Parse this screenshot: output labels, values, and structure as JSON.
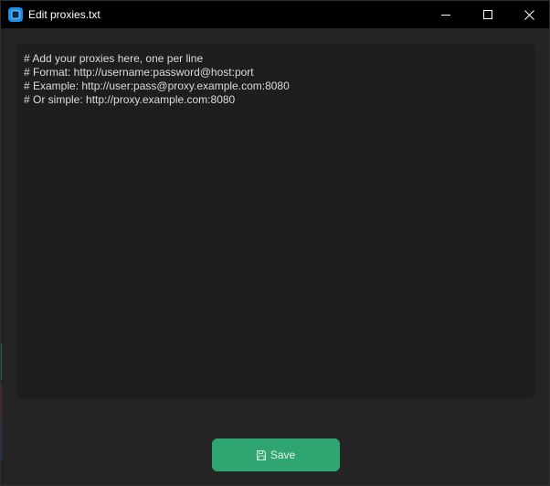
{
  "window": {
    "title": "Edit proxies.txt",
    "icon": "app-icon"
  },
  "titlebar": {
    "controls": [
      "minimize-icon",
      "maximize-icon",
      "close-icon"
    ]
  },
  "editor": {
    "lines": [
      "# Add your proxies here, one per line",
      "# Format: http://username:password@host:port",
      "# Example: http://user:pass@proxy.example.com:8080",
      "# Or simple: http://proxy.example.com:8080"
    ]
  },
  "actions": {
    "save_label": "Save",
    "save_icon": "save-icon"
  },
  "colors": {
    "background": "#242424",
    "titlebar": "#000000",
    "editor_bg": "#1d1e1e",
    "accent": "#2fa572",
    "app_icon": "#1e8fe8"
  }
}
